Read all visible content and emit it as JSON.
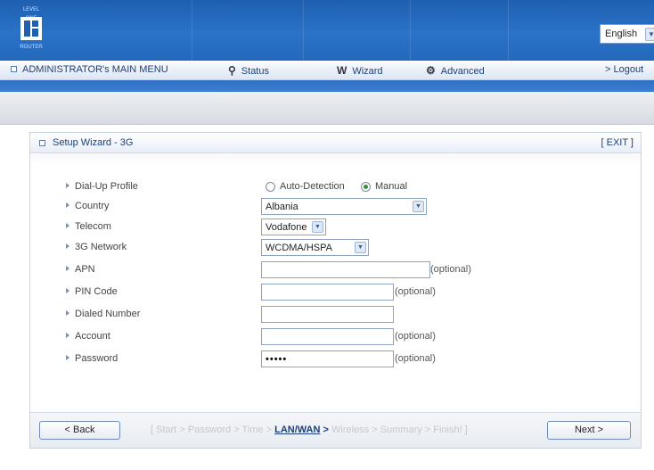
{
  "header": {
    "logo": {
      "tag": "LEVEL ONE",
      "sub": "ROUTER"
    },
    "language": {
      "selected": "English"
    }
  },
  "menu": {
    "admin_label": "ADMINISTRATOR's MAIN MENU",
    "status_label": "Status",
    "wizard_label": "Wizard",
    "advanced_label": "Advanced",
    "logout_label": "> Logout"
  },
  "panel": {
    "title": "Setup Wizard - 3G",
    "exit_label": "[ EXIT ]"
  },
  "form": {
    "dialup": {
      "label": "Dial-Up Profile",
      "options": [
        "Auto-Detection",
        "Manual"
      ],
      "selected": "Manual"
    },
    "country": {
      "label": "Country",
      "value": "Albania"
    },
    "telecom": {
      "label": "Telecom",
      "value": "Vodafone"
    },
    "network": {
      "label": "3G Network",
      "value": "WCDMA/HSPA"
    },
    "apn": {
      "label": "APN",
      "value": "",
      "note": "(optional)"
    },
    "pin": {
      "label": "PIN Code",
      "value": "",
      "note": "(optional)"
    },
    "dialed": {
      "label": "Dialed Number",
      "value": ""
    },
    "account": {
      "label": "Account",
      "value": "",
      "note": "(optional)"
    },
    "password": {
      "label": "Password",
      "value": "•••••",
      "note": "(optional)"
    }
  },
  "footer": {
    "back_label": "< Back",
    "next_label": "Next >",
    "steps_before": "[ Start > Password > Time > ",
    "steps_current": "LAN/WAN",
    "steps_current_arrow": " > ",
    "steps_after": "Wireless > Summary > Finish! ]"
  }
}
